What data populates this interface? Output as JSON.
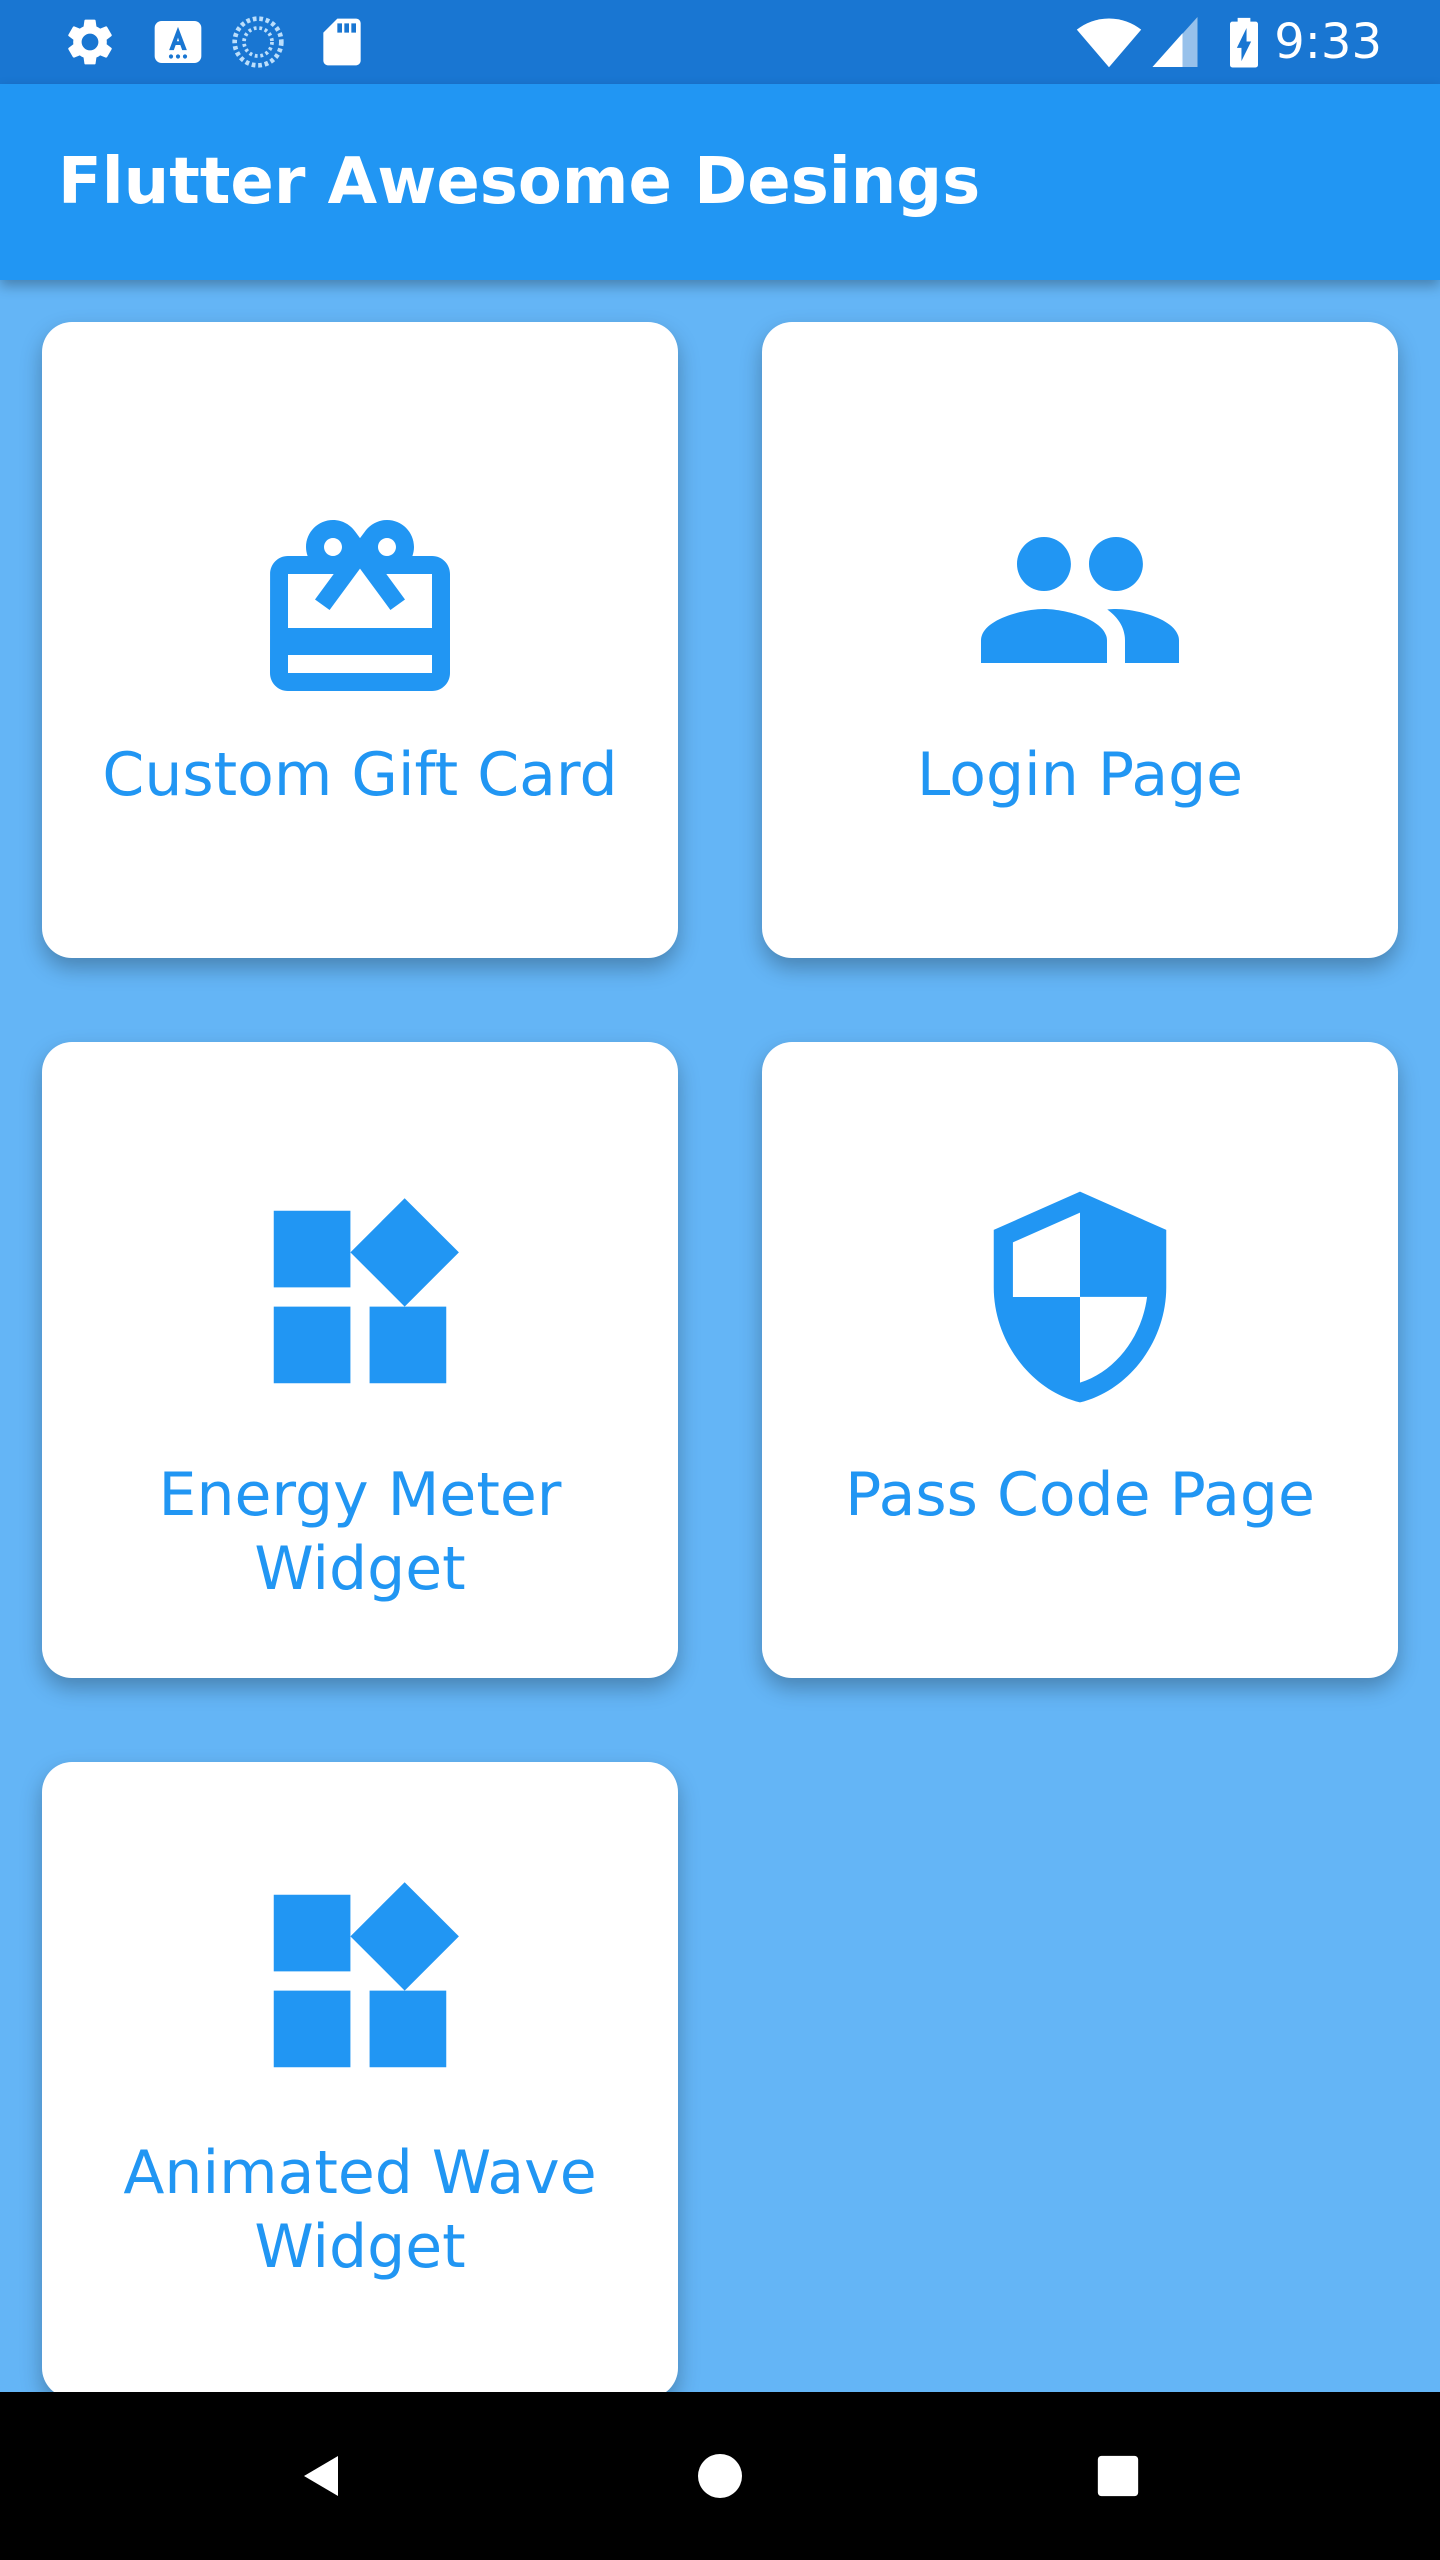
{
  "status_bar": {
    "time": "9:33",
    "left_icons": [
      "settings-icon",
      "accessibility-a-icon",
      "sync-progress-icon",
      "sd-card-icon"
    ],
    "right_icons": [
      "wifi-icon",
      "cell-signal-icon",
      "battery-charging-icon"
    ],
    "background": "#1976d2"
  },
  "app_bar": {
    "title": "Flutter Awesome Desings",
    "background": "#2196f3"
  },
  "grid": {
    "background": "#64b5f6",
    "accent": "#2196f3",
    "items": [
      {
        "label": "Custom Gift Card",
        "icon": "card-giftcard-icon"
      },
      {
        "label": "Login Page",
        "icon": "people-icon"
      },
      {
        "label": "Energy Meter Widget",
        "icon": "widgets-icon"
      },
      {
        "label": "Pass Code Page",
        "icon": "security-shield-icon"
      },
      {
        "label": "Animated Wave Widget",
        "icon": "widgets-icon"
      }
    ]
  },
  "nav_bar": {
    "buttons": [
      "back-triangle-icon",
      "home-circle-icon",
      "recents-square-icon"
    ]
  }
}
